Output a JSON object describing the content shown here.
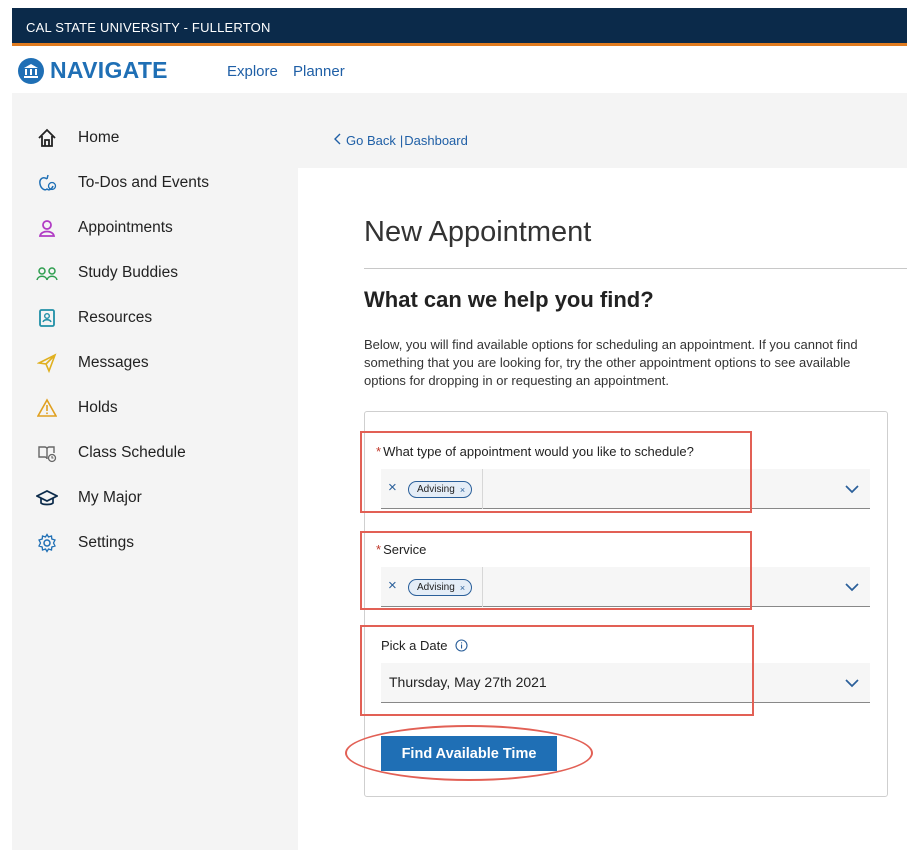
{
  "header": {
    "university": "CAL STATE UNIVERSITY - FULLERTON",
    "brand": "NAVIGATE",
    "links": [
      "Explore",
      "Planner"
    ],
    "brand_color": "#1f6fb5",
    "bar_color": "#0b2a4a",
    "accent_color": "#e07b1f"
  },
  "sidebar": {
    "items": [
      {
        "label": "Home",
        "icon": "home-icon"
      },
      {
        "label": "To-Dos and Events",
        "icon": "apple-check-icon"
      },
      {
        "label": "Appointments",
        "icon": "person-icon"
      },
      {
        "label": "Study Buddies",
        "icon": "people-icon"
      },
      {
        "label": "Resources",
        "icon": "address-book-icon"
      },
      {
        "label": "Messages",
        "icon": "paper-plane-icon"
      },
      {
        "label": "Holds",
        "icon": "warning-icon"
      },
      {
        "label": "Class Schedule",
        "icon": "book-clock-icon"
      },
      {
        "label": "My Major",
        "icon": "graduation-cap-icon"
      },
      {
        "label": "Settings",
        "icon": "gear-icon"
      }
    ]
  },
  "breadcrumb": {
    "back": "Go Back",
    "separator": "|",
    "current": "Dashboard"
  },
  "main": {
    "title": "New Appointment",
    "subtitle": "What can we help you find?",
    "intro": "Below, you will find available options for scheduling an appointment. If you cannot find something that you are looking for, try the other appointment options to see available options for dropping in or requesting an appointment."
  },
  "form": {
    "appointment_type": {
      "label": "What type of appointment would you like to schedule?",
      "required_mark": "*",
      "chip": "Advising",
      "clear": "×"
    },
    "service": {
      "label": "Service",
      "required_mark": "*",
      "chip": "Advising",
      "clear": "×"
    },
    "date": {
      "label": "Pick a Date",
      "value": "Thursday, May 27th 2021",
      "info_icon": "info-icon"
    },
    "submit_label": "Find Available Time"
  }
}
